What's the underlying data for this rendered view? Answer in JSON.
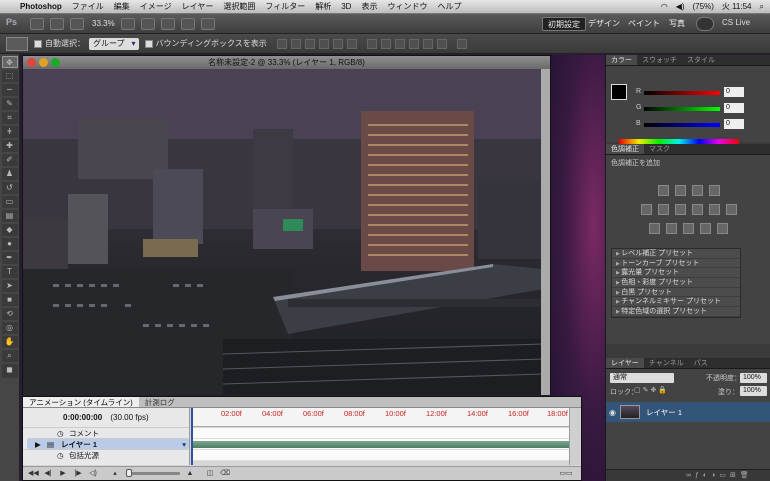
{
  "menubar": {
    "app_name": "Photoshop",
    "items": [
      "ファイル",
      "編集",
      "イメージ",
      "レイヤー",
      "選択範囲",
      "フィルター",
      "解析",
      "3D",
      "表示",
      "ウィンドウ",
      "ヘルプ"
    ],
    "battery": "(75%)",
    "clock": "火 11:54"
  },
  "appbar": {
    "zoom": "33.3%",
    "workspaces": [
      "初期設定",
      "デザイン",
      "ペイント",
      "写真"
    ],
    "cs_live": "CS Live"
  },
  "options": {
    "auto_select_label": "自動選択：",
    "auto_select_value": "グループ",
    "bbox_label": "バウンディングボックスを表示"
  },
  "document": {
    "title": "名称未設定-2 @ 33.3% (レイヤー 1, RGB/8)"
  },
  "animation": {
    "tabs": [
      "アニメーション (タイムライン)",
      "計測ログ"
    ],
    "timecode": "0:00:00:00",
    "fps": "(30.00 fps)",
    "ruler_labels": [
      "02:00f",
      "04:00f",
      "06:00f",
      "08:00f",
      "10:00f",
      "12:00f",
      "14:00f",
      "16:00f",
      "18:00f"
    ],
    "rows": [
      "コメント",
      "レイヤー 1",
      "包括光源"
    ]
  },
  "color_panel": {
    "tabs": [
      "カラー",
      "スウォッチ",
      "スタイル"
    ],
    "channels": [
      {
        "label": "R",
        "value": "0"
      },
      {
        "label": "G",
        "value": "0"
      },
      {
        "label": "B",
        "value": "0"
      }
    ]
  },
  "adjustments": {
    "tabs": [
      "色調補正",
      "マスク"
    ],
    "title": "色調補正を追加",
    "presets": [
      "レベル補正 プリセット",
      "トーンカーブ プリセット",
      "露光量 プリセット",
      "色相・彩度 プリセット",
      "白黒 プリセット",
      "チャンネルミキサー プリセット",
      "特定色域の選択 プリセット"
    ]
  },
  "layers": {
    "tabs": [
      "レイヤー",
      "チャンネル",
      "パス"
    ],
    "blend_mode": "通常",
    "opacity_label": "不透明度：",
    "opacity": "100%",
    "lock_label": "ロック：",
    "fill_label": "塗り：",
    "fill": "100%",
    "layer_name": "レイヤー 1"
  }
}
